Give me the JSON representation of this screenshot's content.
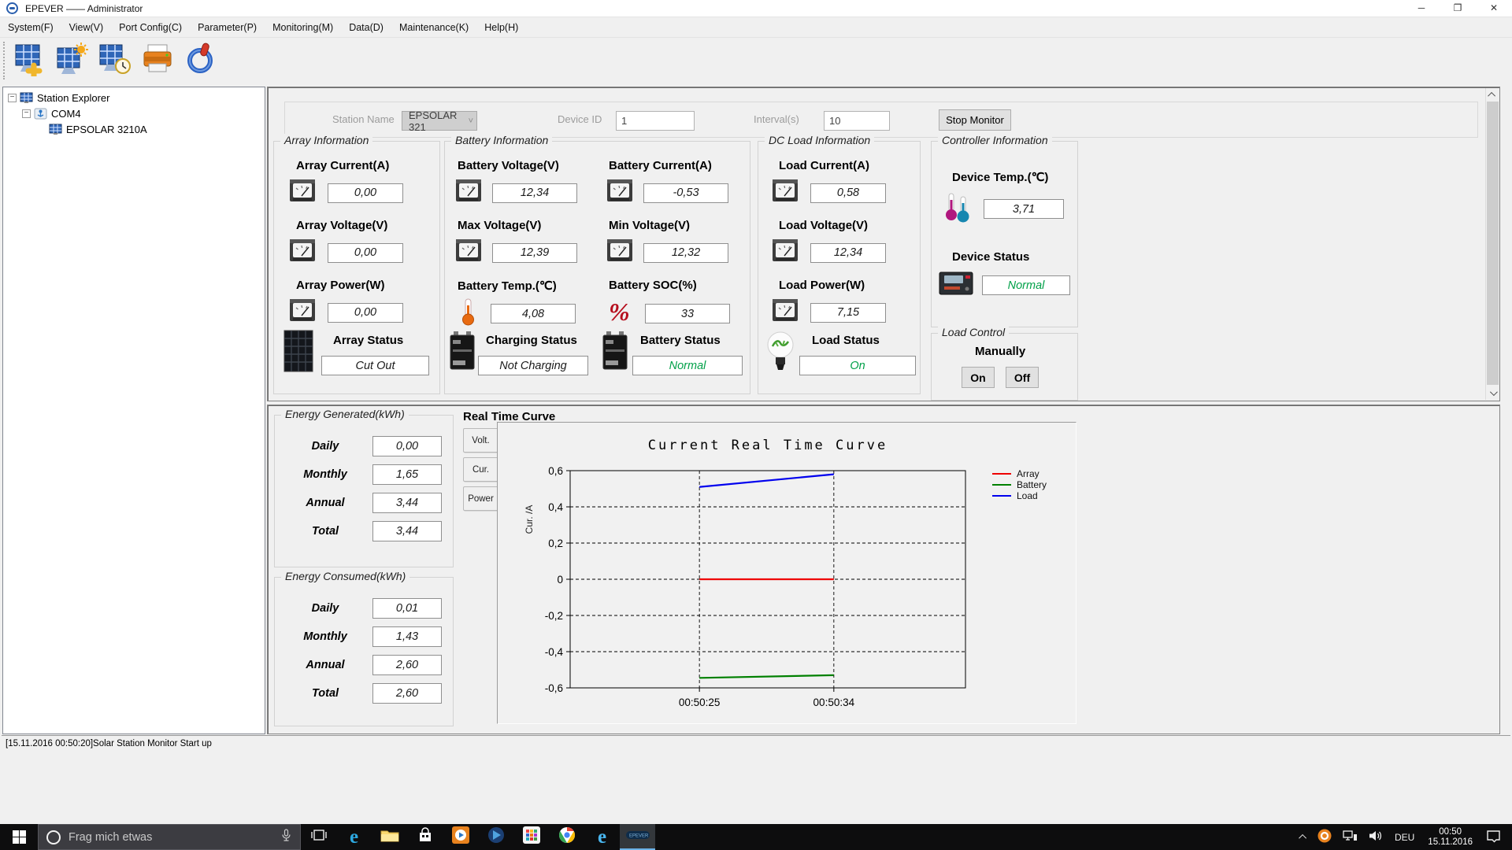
{
  "window": {
    "title": "EPEVER —— Administrator"
  },
  "menu": {
    "items": [
      "System(F)",
      "View(V)",
      "Port Config(C)",
      "Parameter(P)",
      "Monitoring(M)",
      "Data(D)",
      "Maintenance(K)",
      "Help(H)"
    ]
  },
  "toolbar": {
    "buttons": [
      "add-station",
      "station-config",
      "timer-monitor",
      "print",
      "exit"
    ]
  },
  "tree": {
    "root": "Station Explorer",
    "port": "COM4",
    "device": "EPSOLAR 3210A"
  },
  "monitor_bar": {
    "station_name_label": "Station Name",
    "station_name_value": "EPSOLAR 321",
    "device_id_label": "Device ID",
    "device_id_value": "1",
    "interval_label": "Interval(s)",
    "interval_value": "10",
    "stop_button": "Stop Monitor"
  },
  "groups": {
    "array": {
      "title": "Array Information",
      "current": {
        "label": "Array Current(A)",
        "value": "0,00"
      },
      "voltage": {
        "label": "Array Voltage(V)",
        "value": "0,00"
      },
      "power": {
        "label": "Array Power(W)",
        "value": "0,00"
      },
      "status": {
        "label": "Array Status",
        "value": "Cut Out"
      }
    },
    "battery": {
      "title": "Battery Information",
      "voltage": {
        "label": "Battery Voltage(V)",
        "value": "12,34"
      },
      "current": {
        "label": "Battery Current(A)",
        "value": "-0,53"
      },
      "max_voltage": {
        "label": "Max Voltage(V)",
        "value": "12,39"
      },
      "min_voltage": {
        "label": "Min Voltage(V)",
        "value": "12,32"
      },
      "temp": {
        "label": "Battery Temp.(℃)",
        "value": "4,08"
      },
      "soc": {
        "label": "Battery SOC(%)",
        "value": "33"
      },
      "charging": {
        "label": "Charging Status",
        "value": "Not Charging"
      },
      "status": {
        "label": "Battery Status",
        "value": "Normal"
      }
    },
    "dc_load": {
      "title": "DC Load Information",
      "current": {
        "label": "Load Current(A)",
        "value": "0,58"
      },
      "voltage": {
        "label": "Load Voltage(V)",
        "value": "12,34"
      },
      "power": {
        "label": "Load Power(W)",
        "value": "7,15"
      },
      "status": {
        "label": "Load Status",
        "value": "On"
      }
    },
    "controller": {
      "title": "Controller Information",
      "temp": {
        "label": "Device Temp.(℃)",
        "value": "3,71"
      },
      "status": {
        "label": "Device Status",
        "value": "Normal"
      }
    },
    "load_control": {
      "title": "Load Control",
      "manually_label": "Manually",
      "on_button": "On",
      "off_button": "Off"
    }
  },
  "energy_generated": {
    "title": "Energy Generated(kWh)",
    "rows": [
      {
        "label": "Daily",
        "value": "0,00"
      },
      {
        "label": "Monthly",
        "value": "1,65"
      },
      {
        "label": "Annual",
        "value": "3,44"
      },
      {
        "label": "Total",
        "value": "3,44"
      }
    ]
  },
  "energy_consumed": {
    "title": "Energy Consumed(kWh)",
    "rows": [
      {
        "label": "Daily",
        "value": "0,01"
      },
      {
        "label": "Monthly",
        "value": "1,43"
      },
      {
        "label": "Annual",
        "value": "2,60"
      },
      {
        "label": "Total",
        "value": "2,60"
      }
    ]
  },
  "curve": {
    "group_title": "Real Time Curve",
    "tabs": [
      "Volt.",
      "Cur.",
      "Power"
    ]
  },
  "chart_data": {
    "type": "line",
    "title": "Current Real Time Curve",
    "ylabel": "Cur. /A",
    "ylim": [
      -0.6,
      0.6
    ],
    "grid": "dashed",
    "legend_position": "right",
    "yticks": [
      {
        "v": 0.6,
        "label": "0,6"
      },
      {
        "v": 0.4,
        "label": "0,4"
      },
      {
        "v": 0.2,
        "label": "0,2"
      },
      {
        "v": 0,
        "label": "0"
      },
      {
        "v": -0.2,
        "label": "-0,2"
      },
      {
        "v": -0.4,
        "label": "-0,4"
      },
      {
        "v": -0.6,
        "label": "-0,6"
      }
    ],
    "xticks": [
      {
        "f": 0.327,
        "label": "00:50:25"
      },
      {
        "f": 0.667,
        "label": "00:50:34"
      }
    ],
    "series": [
      {
        "name": "Array",
        "color": "#ee0000",
        "points": [
          {
            "f": 0.327,
            "v": 0.0
          },
          {
            "f": 0.667,
            "v": 0.0
          }
        ]
      },
      {
        "name": "Battery",
        "color": "#008000",
        "points": [
          {
            "f": 0.327,
            "v": -0.545
          },
          {
            "f": 0.667,
            "v": -0.53
          }
        ]
      },
      {
        "name": "Load",
        "color": "#0000ee",
        "points": [
          {
            "f": 0.327,
            "v": 0.51
          },
          {
            "f": 0.667,
            "v": 0.58
          }
        ]
      }
    ]
  },
  "log": {
    "text": "[15.11.2016 00:50:20]Solar Station Monitor Start up"
  },
  "taskbar": {
    "search_placeholder": "Frag mich etwas",
    "language": "DEU",
    "time": "00:50",
    "date": "15.11.2016"
  },
  "colors": {
    "status_green": "#00a048",
    "series_array": "#ee0000",
    "series_battery": "#008000",
    "series_load": "#0000ee"
  }
}
